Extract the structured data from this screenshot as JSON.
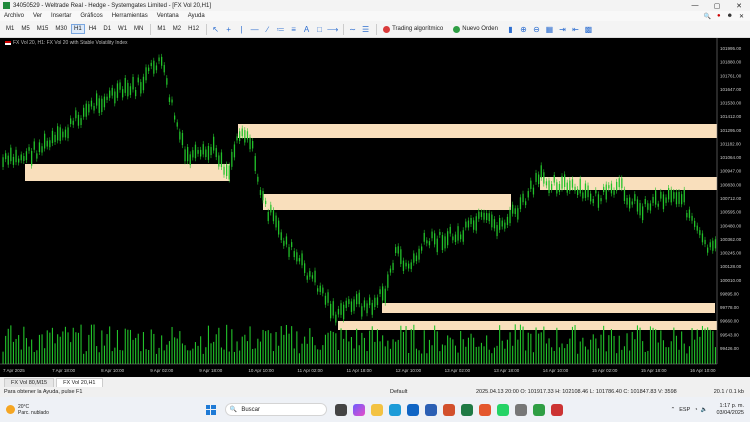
{
  "window": {
    "title": "34050529 - Weltrade Real - Hedge - Systemgates Limited - [FX Vol 20,H1]",
    "controls": [
      "—",
      "▢",
      "✕"
    ]
  },
  "menu": {
    "items": [
      "Archivo",
      "Ver",
      "Insertar",
      "Gráficos",
      "Herramientas",
      "Ventana",
      "Ayuda"
    ]
  },
  "toolbar": {
    "timeframes": [
      "M1",
      "M5",
      "M15",
      "M30",
      "H1",
      "H4",
      "D1",
      "W1",
      "MN"
    ],
    "extra_timeframes": [
      "M1",
      "M2",
      "H12"
    ],
    "algo_label": "Trading algorítmico",
    "new_order_label": "Nuevo Orden",
    "accent": "#2f6fd0"
  },
  "chart": {
    "label": "FX Vol 20, H1: FX Vol 20 with Stable Volatility Index",
    "bg": "#000000",
    "candle_color": "#22c22a",
    "zone_color": "#f9dfbc",
    "price_labels": [
      "101995.00",
      "101880.00",
      "101761.00",
      "101647.00",
      "101530.00",
      "101412.00",
      "101295.00",
      "101182.00",
      "101064.00",
      "100947.00",
      "100830.00",
      "100712.00",
      "100595.00",
      "100480.00",
      "100362.00",
      "100245.00",
      "100128.00",
      "100010.00",
      "99895.00",
      "99778.00",
      "99660.00",
      "99543.00",
      "99426.00"
    ],
    "time_labels": [
      "7 Apr 2025",
      "7 Apr 18:00",
      "8 Apr 10:00",
      "9 Apr 02:00",
      "9 Apr 18:00",
      "10 Apr 10:00",
      "11 Apr 02:00",
      "11 Apr 18:00",
      "12 Apr 10:00",
      "13 Apr 02:00",
      "13 Apr 18:00",
      "14 Apr 10:00",
      "15 Apr 02:00",
      "15 Apr 18:00",
      "16 Apr 10:00"
    ]
  },
  "tabs": [
    "FX Vol 80,M15",
    "FX Vol 20,H1"
  ],
  "status": {
    "help": "Para obtener la Ayuda, pulse F1",
    "profile": "Default",
    "ohlc": "2025.04.13 20:00   O: 101917.33   H: 102108.46   L: 101786.40   C: 101847.83   V: 3598",
    "connection": "20.1 / 0.1 kb"
  },
  "taskbar": {
    "weather_temp": "20°C",
    "weather_desc": "Parc. nublado",
    "search_placeholder": "Buscar",
    "clock_time": "1:17 p. m.",
    "clock_date": "03/04/2025",
    "tray_lang": "ESP"
  }
}
